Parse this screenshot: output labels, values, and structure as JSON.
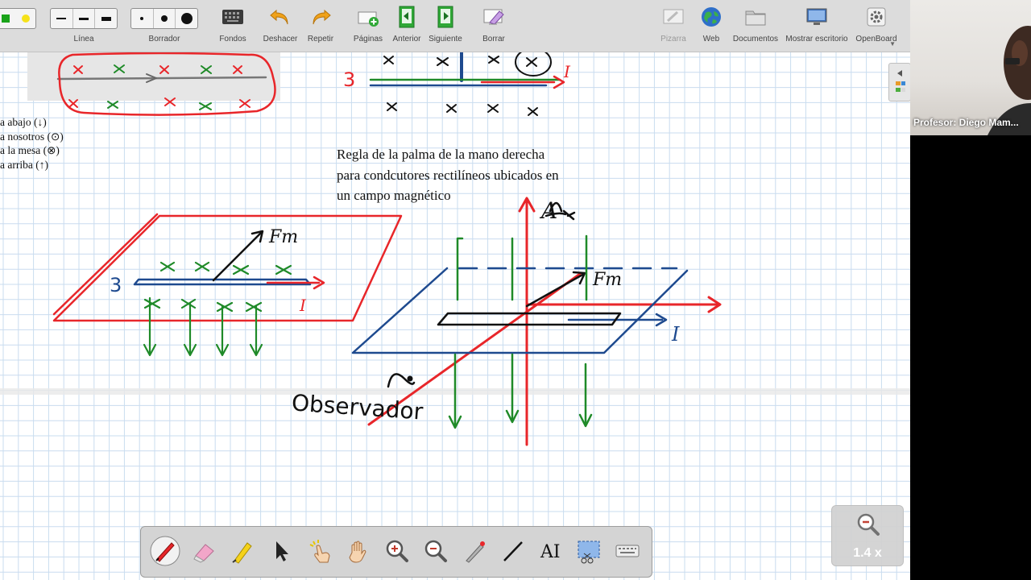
{
  "toolbar": {
    "linea_label": "Línea",
    "borrador_label": "Borrador",
    "fondos_label": "Fondos",
    "deshacer_label": "Deshacer",
    "repetir_label": "Repetir",
    "paginas_label": "Páginas",
    "anterior_label": "Anterior",
    "siguiente_label": "Siguiente",
    "borrar_label": "Borrar",
    "pizarra_label": "Pizarra",
    "web_label": "Web",
    "documentos_label": "Documentos",
    "mostrar_escritorio_label": "Mostrar escritorio",
    "openboard_label": "OpenBoard"
  },
  "board": {
    "legend_lines": [
      "a abajo (↓)",
      "a nosotros (⊙)",
      "a la mesa (⊗)",
      "a arriba (↑)"
    ],
    "rule_lines": [
      "Regla de la palma de la mano derecha",
      "para condcutores rectilíneos ubicados en",
      "un campo magnético"
    ],
    "ink_number_top": "3",
    "ink_number_left": "3",
    "ink_current_label": "I",
    "ink_force_label": "Fm",
    "ink_observer_label": "Observador",
    "ink_axis_label": "A"
  },
  "video": {
    "name": "Profesor: Diego Mam..."
  },
  "zoom": {
    "value": "1.4 x"
  },
  "colors": {
    "ink_red": "#e8262a",
    "ink_green": "#1f8a28",
    "ink_blue": "#1e4a8f",
    "toolbar_bg": "#dcdcdc"
  }
}
